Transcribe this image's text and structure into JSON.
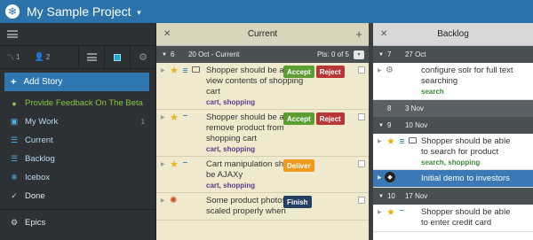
{
  "header": {
    "logo_icon": "snowflake-icon",
    "title": "My Sample Project"
  },
  "sidebar": {
    "velocity": "1",
    "members": "2",
    "add_story_label": "Add Story",
    "items": [
      {
        "label": "Provide Feedback On The Beta",
        "icon": "chat-icon",
        "count": ""
      },
      {
        "label": "My Work",
        "icon": "inbox-icon",
        "count": "1"
      },
      {
        "label": "Current",
        "icon": "list-icon",
        "count": ""
      },
      {
        "label": "Backlog",
        "icon": "list-icon",
        "count": ""
      },
      {
        "label": "Icebox",
        "icon": "snowflake-icon",
        "count": ""
      },
      {
        "label": "Done",
        "icon": "check-icon",
        "count": ""
      }
    ],
    "epics_label": "Epics"
  },
  "current": {
    "title": "Current",
    "iteration": {
      "num": "6",
      "date": "20 Oct - Current",
      "points": "Pts: 0 of 5"
    },
    "stories": [
      {
        "name": "Shopper should be able to view contents of shopping cart",
        "labels": "cart, shopping",
        "btn1": "Accept",
        "btn2": "Reject"
      },
      {
        "name": "Shopper should be able to remove product from shopping cart",
        "labels": "cart, shopping",
        "btn1": "Accept",
        "btn2": "Reject"
      },
      {
        "name": "Cart manipulation should be AJAXy",
        "labels": "cart, shopping",
        "btn1": "Deliver"
      },
      {
        "name": "Some product photos not scaled properly when",
        "labels": "",
        "btn1": "Finish"
      }
    ]
  },
  "backlog": {
    "title": "Backlog",
    "iterations": [
      {
        "num": "7",
        "date": "27 Oct"
      },
      {
        "num": "8",
        "date": "3 Nov"
      },
      {
        "num": "9",
        "date": "10 Nov"
      },
      {
        "num": "10",
        "date": "17 Nov"
      }
    ],
    "stories": [
      {
        "name": "configure solr for full text searching",
        "labels": "search"
      },
      {
        "name": "Shopper should be able to search for product",
        "labels": "search, shopping"
      },
      {
        "name": "Initial demo to investors",
        "labels": ""
      },
      {
        "name": "Shopper should be able to enter credit card",
        "labels": ""
      }
    ]
  },
  "colors": {
    "header": "#2a72a8",
    "accept": "#5c9e32",
    "reject": "#b83638",
    "deliver": "#ef9a1d",
    "finish": "#233f64",
    "selected": "#3a79b6"
  }
}
